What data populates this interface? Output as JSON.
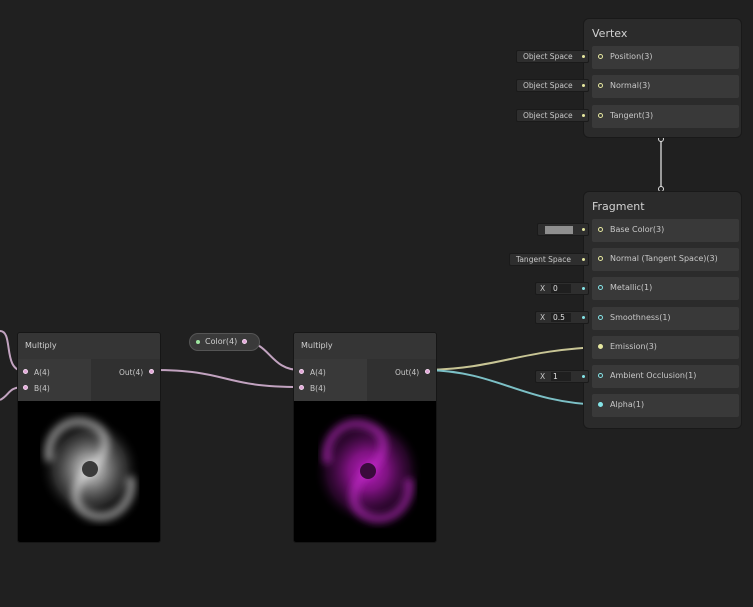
{
  "vertex": {
    "title": "Vertex",
    "slots": [
      {
        "label": "Position(3)",
        "field": "Object Space"
      },
      {
        "label": "Normal(3)",
        "field": "Object Space"
      },
      {
        "label": "Tangent(3)",
        "field": "Object Space"
      }
    ]
  },
  "fragment": {
    "title": "Fragment",
    "slots": [
      {
        "label": "Base Color(3)"
      },
      {
        "label": "Normal (Tangent Space)(3)",
        "field": "Tangent Space"
      },
      {
        "label": "Metallic(1)",
        "x_label": "X",
        "value": "0"
      },
      {
        "label": "Smoothness(1)",
        "x_label": "X",
        "value": "0.5"
      },
      {
        "label": "Emission(3)"
      },
      {
        "label": "Ambient Occlusion(1)",
        "x_label": "X",
        "value": "1"
      },
      {
        "label": "Alpha(1)"
      }
    ]
  },
  "multiply_left": {
    "title": "Multiply",
    "in_a": "A(4)",
    "in_b": "B(4)",
    "out": "Out(4)"
  },
  "color_property": {
    "label": "Color(4)"
  },
  "multiply_right": {
    "title": "Multiply",
    "in_a": "A(4)",
    "in_b": "B(4)",
    "out": "Out(4)"
  },
  "colors": {
    "background": "#202020",
    "vector3_port": "#e6e8a0",
    "float_port": "#84e4e7",
    "vector4_port": "#fbcbf4",
    "preview_grey": "#bdbdbd",
    "preview_magenta": "#a21aa8"
  }
}
